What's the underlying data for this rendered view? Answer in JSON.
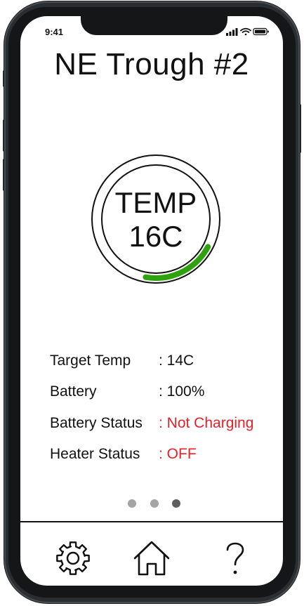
{
  "status_bar": {
    "time": "9:41"
  },
  "page": {
    "title": "NE Trough #2"
  },
  "gauge": {
    "label": "TEMP",
    "value": "16C",
    "fill_fraction": 0.2,
    "accent_color": "#2ea30f"
  },
  "info_rows": [
    {
      "label": "Target Temp",
      "value": ": 14C",
      "status": "normal"
    },
    {
      "label": "Battery",
      "value": ": 100%",
      "status": "normal"
    },
    {
      "label": "Battery Status",
      "value": ": Not Charging",
      "status": "alert"
    },
    {
      "label": "Heater Status",
      "value": ": OFF",
      "status": "alert"
    }
  ],
  "pager": {
    "total": 3,
    "active_index": 2
  },
  "nav": {
    "items": [
      {
        "icon": "gear-icon"
      },
      {
        "icon": "home-icon"
      },
      {
        "icon": "question-icon"
      }
    ]
  },
  "colors": {
    "alert": "#e8202a",
    "accent": "#2ea30f"
  }
}
